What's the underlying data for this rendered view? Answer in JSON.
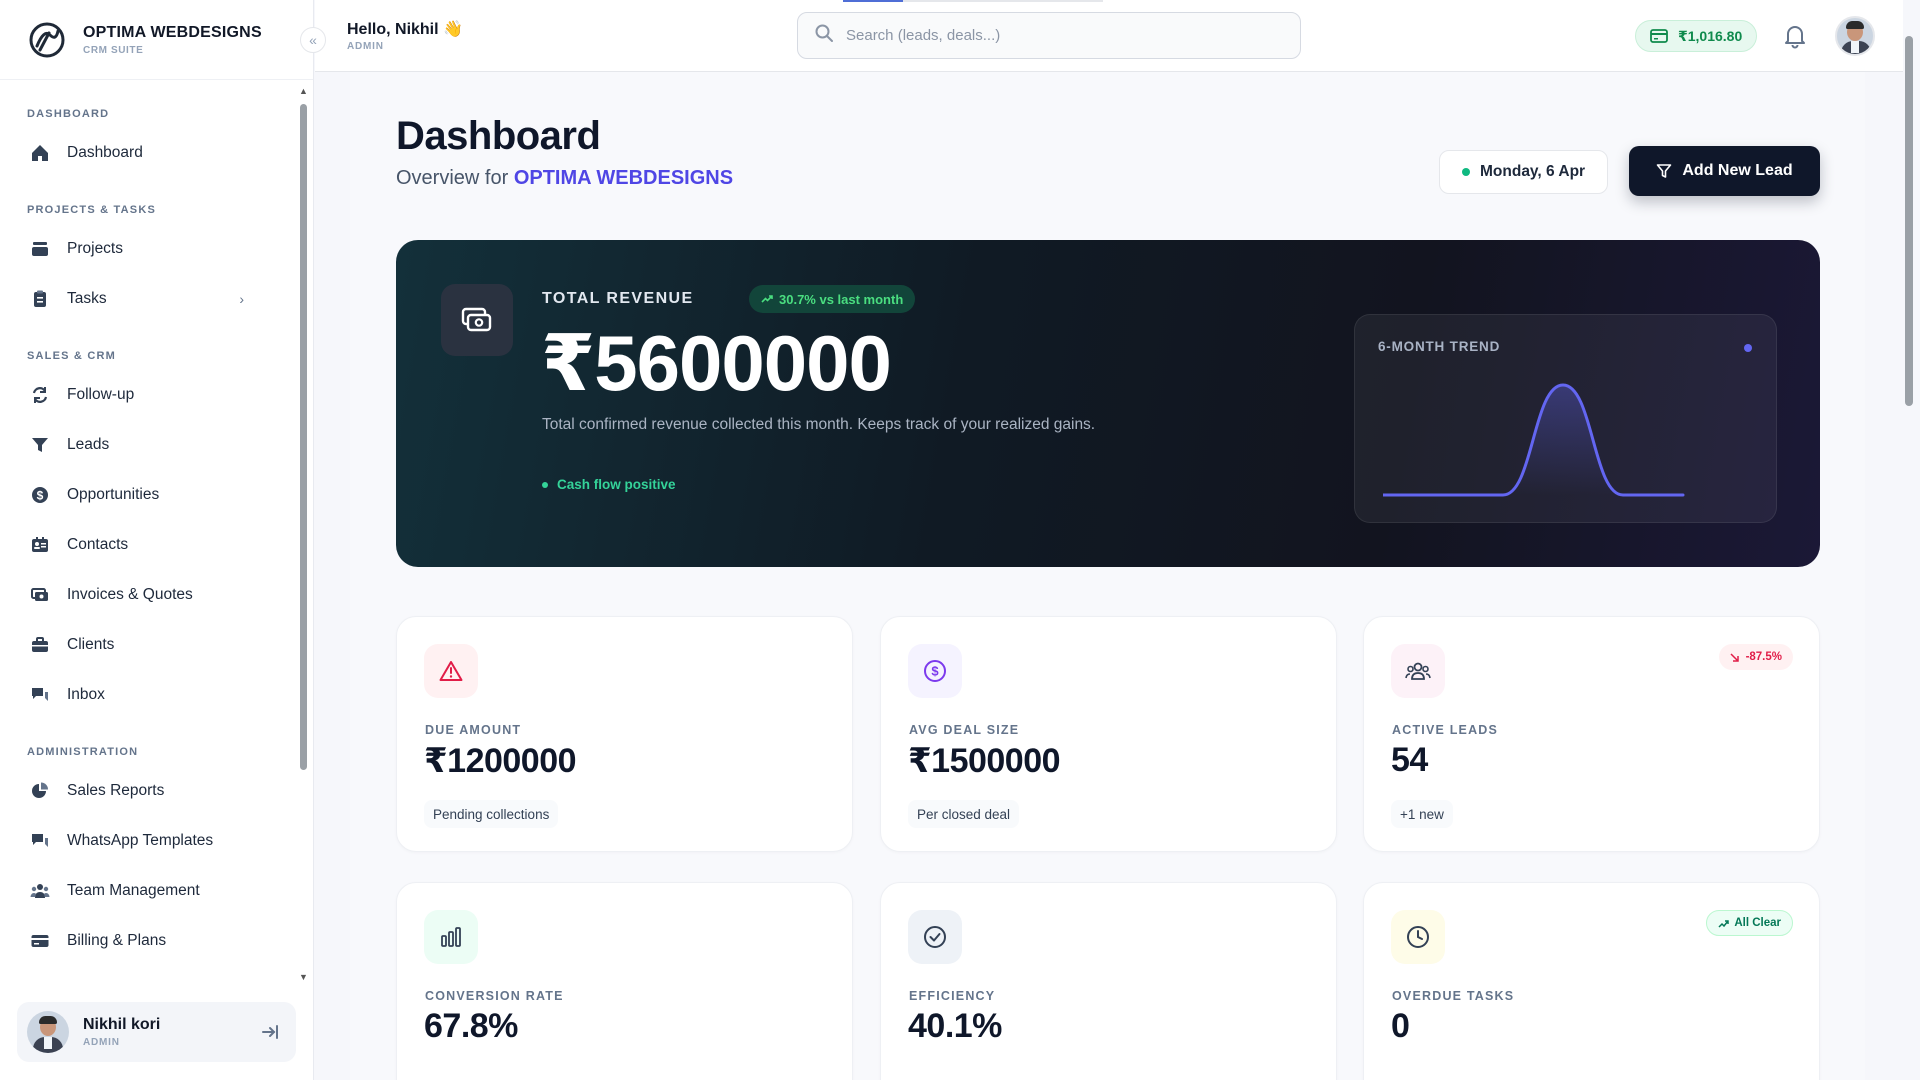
{
  "brand": {
    "name": "OPTIMA WEBDESIGNS",
    "subtitle": "CRM SUITE",
    "collapse": "«"
  },
  "sidebar": {
    "sections": [
      {
        "title": "DASHBOARD",
        "items": [
          {
            "label": "Dashboard",
            "icon": "home-icon"
          }
        ]
      },
      {
        "title": "PROJECTS & TASKS",
        "items": [
          {
            "label": "Projects",
            "icon": "layers-icon"
          },
          {
            "label": "Tasks",
            "icon": "clipboard-icon",
            "chevron": "›"
          }
        ]
      },
      {
        "title": "SALES & CRM",
        "items": [
          {
            "label": "Follow-up",
            "icon": "refresh-icon"
          },
          {
            "label": "Leads",
            "icon": "funnel-icon"
          },
          {
            "label": "Opportunities",
            "icon": "dollar-circle-icon"
          },
          {
            "label": "Contacts",
            "icon": "contact-card-icon"
          },
          {
            "label": "Invoices & Quotes",
            "icon": "money-icon"
          },
          {
            "label": "Clients",
            "icon": "briefcase-icon"
          },
          {
            "label": "Inbox",
            "icon": "chat-icon"
          }
        ]
      },
      {
        "title": "ADMINISTRATION",
        "items": [
          {
            "label": "Sales Reports",
            "icon": "pie-chart-icon"
          },
          {
            "label": "WhatsApp Templates",
            "icon": "chat-bubbles-icon"
          },
          {
            "label": "Team Management",
            "icon": "team-icon"
          },
          {
            "label": "Billing & Plans",
            "icon": "credit-card-icon"
          }
        ]
      }
    ]
  },
  "user": {
    "name": "Nikhil kori",
    "role": "ADMIN"
  },
  "topbar": {
    "greeting": "Hello, Nikhil 👋",
    "role": "ADMIN",
    "search_placeholder": "Search (leads, deals...)",
    "wallet_balance": "₹1,016.80"
  },
  "header": {
    "title": "Dashboard",
    "subtitle_prefix": "Overview for",
    "organization": "OPTIMA WEBDESIGNS",
    "date": "Monday, 6 Apr",
    "add_lead_label": "Add New Lead"
  },
  "hero": {
    "label": "TOTAL REVENUE",
    "badge": "30.7% vs last month",
    "value": "₹5600000",
    "description": "Total confirmed revenue collected this month. Keeps track of your realized gains.",
    "status": "Cash flow positive",
    "trend_title": "6-MONTH TREND",
    "trend_values": [
      0,
      0,
      0,
      1,
      0,
      0
    ],
    "colors": {
      "trend_line": "#6366f1",
      "positive": "#34d399"
    }
  },
  "stats": [
    {
      "label": "DUE AMOUNT",
      "value": "₹1200000",
      "note": "Pending collections",
      "icon": "warning-icon",
      "color": "#e11d48"
    },
    {
      "label": "AVG DEAL SIZE",
      "value": "₹1500000",
      "note": "Per closed deal",
      "icon": "dollar-circle-icon",
      "color": "#7c3aed"
    },
    {
      "label": "ACTIVE LEADS",
      "value": "54",
      "note": "+1 new",
      "icon": "users-icon",
      "badge": "-87.5%",
      "color": "#db2777"
    },
    {
      "label": "CONVERSION RATE",
      "value": "67.8%",
      "icon": "bar-chart-icon",
      "color": "#10b981"
    },
    {
      "label": "EFFICIENCY",
      "value": "40.1%",
      "icon": "check-circle-icon",
      "color": "#334155"
    },
    {
      "label": "OVERDUE TASKS",
      "value": "0",
      "icon": "clock-icon",
      "badge": "All Clear",
      "color": "#1f2937"
    }
  ]
}
